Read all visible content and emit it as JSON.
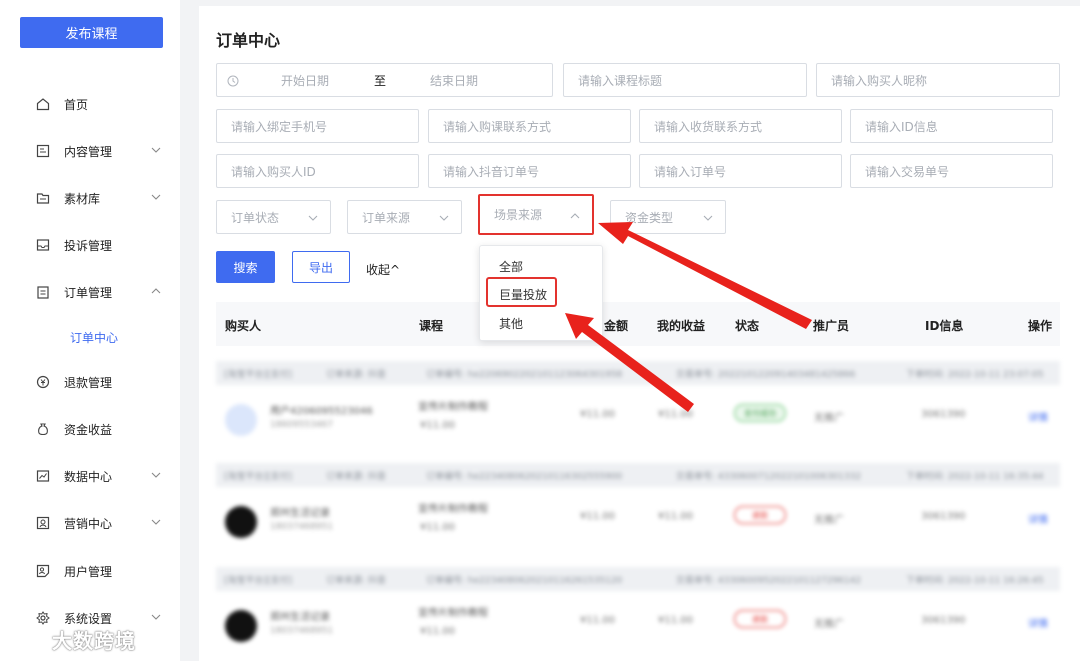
{
  "sidebar": {
    "publish_button": "发布课程",
    "items": [
      {
        "label": "首页",
        "icon": "home-icon"
      },
      {
        "label": "内容管理",
        "icon": "content-icon"
      },
      {
        "label": "素材库",
        "icon": "folder-icon"
      },
      {
        "label": "投诉管理",
        "icon": "inbox-icon"
      },
      {
        "label": "订单管理",
        "icon": "clipboard-icon"
      },
      {
        "label": "订单中心",
        "icon": ""
      },
      {
        "label": "退款管理",
        "icon": "refund-icon"
      },
      {
        "label": "资金收益",
        "icon": "money-bag-icon"
      },
      {
        "label": "数据中心",
        "icon": "chart-icon"
      },
      {
        "label": "营销中心",
        "icon": "marketing-icon"
      },
      {
        "label": "用户管理",
        "icon": "user-card-icon"
      },
      {
        "label": "系统设置",
        "icon": "gear-icon"
      }
    ]
  },
  "main": {
    "title": "订单中心",
    "date_range": {
      "start_placeholder": "开始日期",
      "separator": "至",
      "end_placeholder": "结束日期"
    },
    "filters": {
      "course_title": "请输入课程标题",
      "buyer_nickname": "请输入购买人昵称",
      "bound_phone": "请输入绑定手机号",
      "buy_contact": "请输入购课联系方式",
      "ship_contact": "请输入收货联系方式",
      "id_info": "请输入ID信息",
      "buyer_id": "请输入购买人ID",
      "douyin_order": "请输入抖音订单号",
      "order_no": "请输入订单号",
      "trade_no": "请输入交易单号"
    },
    "selects": {
      "order_status": "订单状态",
      "order_source": "订单来源",
      "scene_source": "场景来源",
      "fund_type": "资金类型"
    },
    "dropdown_options": [
      "全部",
      "巨量投放",
      "其他"
    ],
    "buttons": {
      "search": "搜索",
      "export": "导出",
      "collapse": "收起"
    },
    "table_headers": {
      "buyer": "购买人",
      "course": "课程",
      "amount": "金额",
      "my_income": "我的收益",
      "status": "状态",
      "promoter": "推广员",
      "id_info": "ID信息",
      "actions": "操作"
    },
    "orders": [
      {
        "platform": "[淘宝平台][支付]",
        "source": "订单来源: 抖音",
        "order_no": "订单编号: he2206902202101123064301958",
        "trade_no": "交易单号: 202210122091403481425866",
        "time": "下单时间: 2022-10-11 23:07:05",
        "buyer_name": "用户4206095523046",
        "buyer_phone": "18609553467",
        "course": "宣传片制作教程",
        "price": "¥11.00",
        "amount": "¥11.00",
        "income": "¥11.00",
        "status": "支付成功",
        "promoter": "无推广",
        "id_info": "3061390",
        "action": "详情"
      },
      {
        "platform": "[淘宝平台][支付]",
        "source": "订单来源: 抖音",
        "order_no": "订单编号: he2234080620210116302555900",
        "trade_no": "交易单号: 4330600712022101006301332",
        "time": "下单时间: 2022-10-11 16:35:44",
        "buyer_name": "郑州生活记录",
        "buyer_phone": "18037468951",
        "course": "宣传片制作教程",
        "price": "¥11.00",
        "amount": "¥11.00",
        "income": "¥11.00",
        "status": "退款",
        "promoter": "无推广",
        "id_info": "3061390",
        "action": "详情"
      },
      {
        "platform": "[淘宝平台][支付]",
        "source": "订单来源: 抖音",
        "order_no": "订单编号: he2234080620210116261535120",
        "trade_no": "交易单号: 4330600952022101127296142",
        "time": "下单时间: 2022-10-11 16:26:45",
        "buyer_name": "郑州生活记录",
        "buyer_phone": "18037468951",
        "course": "宣传片制作教程",
        "price": "¥11.00",
        "amount": "¥11.00",
        "income": "¥11.00",
        "status": "退款",
        "promoter": "无推广",
        "id_info": "3061390",
        "action": "详情"
      }
    ]
  },
  "watermark": "大数跨境",
  "colors": {
    "accent": "#3f6bf0",
    "highlight": "#e3332e",
    "success": "#5cc26a"
  }
}
